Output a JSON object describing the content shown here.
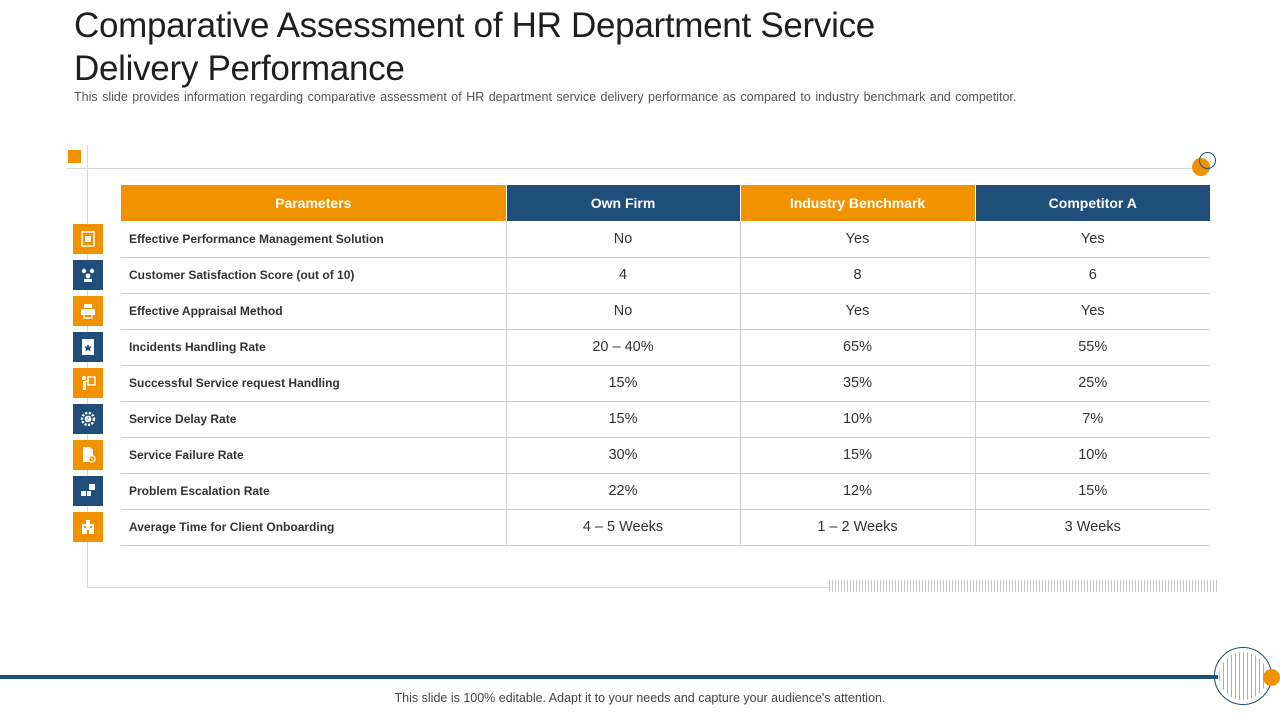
{
  "slide": {
    "title": "Comparative Assessment of HR Department Service Delivery Performance",
    "subtitle": "This slide provides information regarding comparative assessment of HR department service delivery performance as compared to industry benchmark and competitor.",
    "footer": "This slide is 100% editable. Adapt it to your needs and capture your audience's attention."
  },
  "colors": {
    "accent_orange": "#f39200",
    "accent_navy": "#1e4e79"
  },
  "table": {
    "headers": [
      "Parameters",
      "Own Firm",
      "Industry Benchmark",
      "Competitor A"
    ],
    "rows": [
      {
        "param": "Effective Performance Management Solution",
        "own": "No",
        "bench": "Yes",
        "comp": "Yes",
        "icon": "performance-document-icon"
      },
      {
        "param": "Customer Satisfaction Score (out of 10)",
        "own": "4",
        "bench": "8",
        "comp": "6",
        "icon": "customer-group-icon"
      },
      {
        "param": "Effective Appraisal Method",
        "own": "No",
        "bench": "Yes",
        "comp": "Yes",
        "icon": "appraisal-printer-icon"
      },
      {
        "param": "Incidents Handling Rate",
        "own": "20 – 40%",
        "bench": "65%",
        "comp": "55%",
        "icon": "star-document-icon"
      },
      {
        "param": "Successful Service request Handling",
        "own": "15%",
        "bench": "35%",
        "comp": "25%",
        "icon": "presenter-icon"
      },
      {
        "param": "Service Delay Rate",
        "own": "15%",
        "bench": "10%",
        "comp": "7%",
        "icon": "gear-question-icon"
      },
      {
        "param": "Service Failure Rate",
        "own": "30%",
        "bench": "15%",
        "comp": "10%",
        "icon": "document-error-icon"
      },
      {
        "param": "Problem Escalation Rate",
        "own": "22%",
        "bench": "12%",
        "comp": "15%",
        "icon": "escalation-blocks-icon"
      },
      {
        "param": "Average Time for Client Onboarding",
        "own": "4 – 5 Weeks",
        "bench": "1 – 2 Weeks",
        "comp": "3 Weeks",
        "icon": "building-onboarding-icon"
      }
    ]
  }
}
